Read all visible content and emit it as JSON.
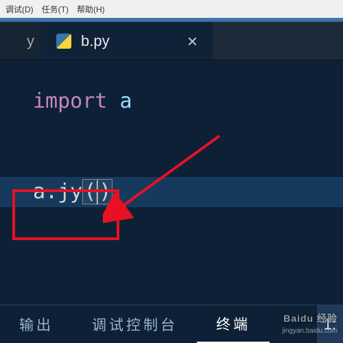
{
  "menubar": {
    "debug": "调试(D)",
    "tasks": "任务(T)",
    "help": "帮助(H)"
  },
  "tabs": {
    "inactive_suffix": "y",
    "active_filename": "b.py",
    "close_glyph": "×"
  },
  "code": {
    "line1_keyword": "import",
    "line1_module": "a",
    "line3_obj": "a",
    "line3_dot": ".",
    "line3_method": "jy",
    "line3_lparen": "(",
    "line3_rparen": ")"
  },
  "panels": {
    "output": "输出",
    "debug_console": "调试控制台",
    "terminal": "终端"
  },
  "status": {
    "pos": "1:"
  },
  "watermark": {
    "main": "Baidu 经验",
    "sub": "jingyan.baidu.com"
  },
  "colors": {
    "annotation": "#e81123"
  }
}
